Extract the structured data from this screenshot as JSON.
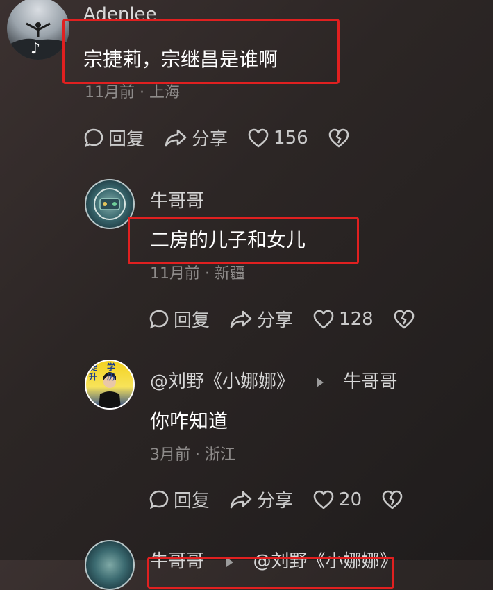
{
  "comments": [
    {
      "username": "Adenlee",
      "content": "宗捷莉，宗继昌是谁啊",
      "meta": "11月前 · 上海",
      "reply_label": "回复",
      "share_label": "分享",
      "likes": "156"
    },
    {
      "username": "牛哥哥",
      "content": "二房的儿子和女儿",
      "meta": "11月前 · 新疆",
      "reply_label": "回复",
      "share_label": "分享",
      "likes": "128"
    },
    {
      "username": "@刘野《小娜娜》",
      "reply_to": "牛哥哥",
      "content": "你咋知道",
      "meta": "3月前 · 浙江",
      "reply_label": "回复",
      "share_label": "分享",
      "likes": "20"
    },
    {
      "username": "牛哥哥",
      "reply_to": "@刘野《小娜娜》"
    }
  ],
  "avatar3_text": "提学升历",
  "colors": {
    "highlight": "#e02020",
    "background": "#2c2625"
  }
}
